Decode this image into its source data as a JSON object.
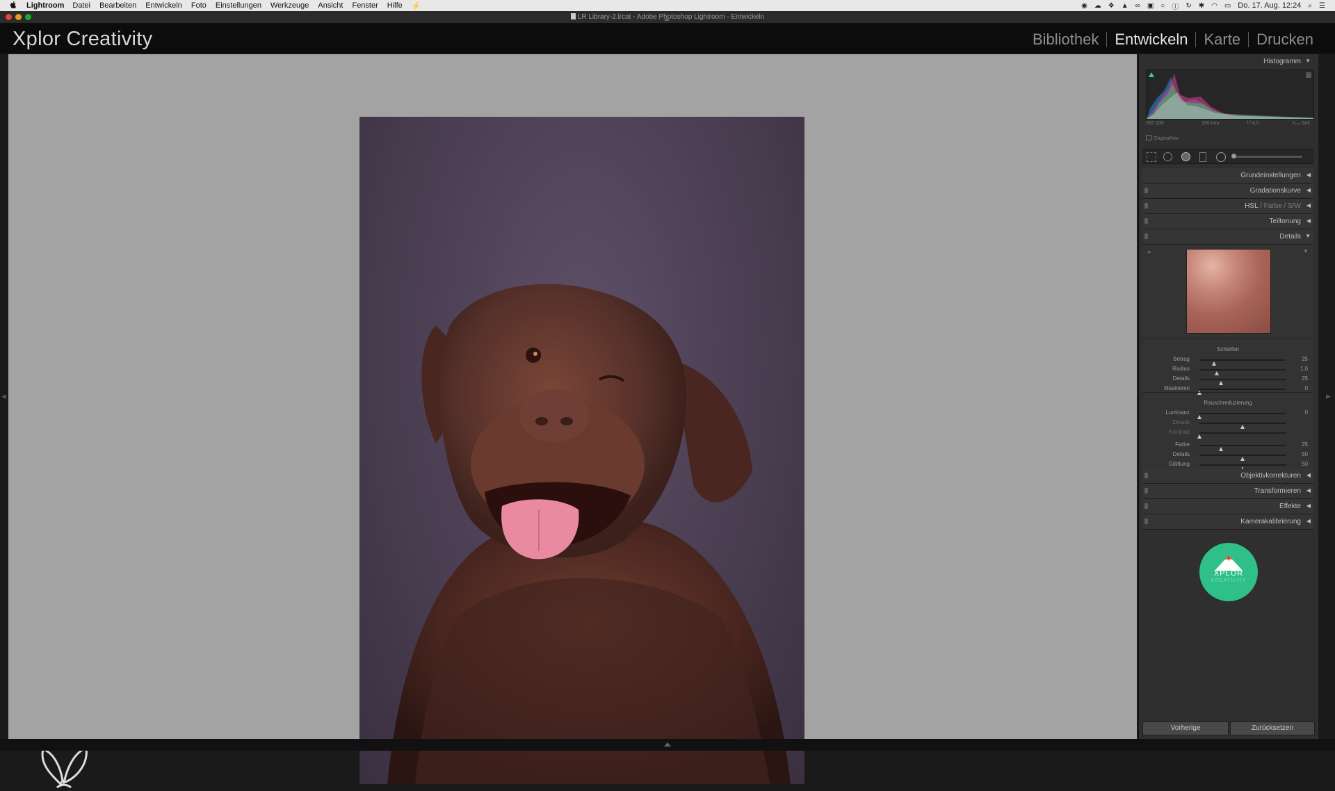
{
  "menubar": {
    "app": "Lightroom",
    "items": [
      "Datei",
      "Bearbeiten",
      "Entwickeln",
      "Foto",
      "Einstellungen",
      "Werkzeuge",
      "Ansicht",
      "Fenster",
      "Hilfe"
    ],
    "datetime": "Do. 17. Aug.  12:24"
  },
  "window": {
    "title": "LR Library-2.lrcat - Adobe Photoshop Lightroom - Entwickeln"
  },
  "identity": {
    "brand": "Xplor Creativity",
    "modules": [
      {
        "label": "Bibliothek",
        "active": false
      },
      {
        "label": "Entwickeln",
        "active": true
      },
      {
        "label": "Karte",
        "active": false
      },
      {
        "label": "Drucken",
        "active": false
      }
    ]
  },
  "histogram": {
    "title": "Histogramm",
    "iso": "ISO 100",
    "focal": "100 mm",
    "aperture": "f / 4,0",
    "shutter": "¹⁄₁₂₅ Sek.",
    "original_photo": "Originalfoto"
  },
  "panels": {
    "grundeinstellungen": "Grundeinstellungen",
    "gradationskurve": "Gradationskurve",
    "hsl": "HSL",
    "farbe": "Farbe",
    "sw": "S/W",
    "teiltonung": "Teiltonung",
    "details": "Details",
    "objektivkorrekturen": "Objektivkorrekturen",
    "transformieren": "Transformieren",
    "effekte": "Effekte",
    "kamerakalibrierung": "Kamerakalibrierung"
  },
  "details": {
    "schaerfen_title": "Schärfen",
    "schaerfen": [
      {
        "label": "Betrag",
        "value": "25",
        "pos": 0.17
      },
      {
        "label": "Radius",
        "value": "1,0",
        "pos": 0.2
      },
      {
        "label": "Details",
        "value": "25",
        "pos": 0.25
      },
      {
        "label": "Maskieren",
        "value": "0",
        "pos": 0.0
      }
    ],
    "rauschen_title": "Rauschreduzierung",
    "rauschen_lum": [
      {
        "label": "Luminanz",
        "value": "0",
        "pos": 0.0,
        "dim": false
      },
      {
        "label": "Details",
        "value": "",
        "pos": 0.5,
        "dim": true
      },
      {
        "label": "Kontrast",
        "value": "",
        "pos": 0.0,
        "dim": true
      }
    ],
    "rauschen_color": [
      {
        "label": "Farbe",
        "value": "25",
        "pos": 0.25
      },
      {
        "label": "Details",
        "value": "50",
        "pos": 0.5
      },
      {
        "label": "Glättung",
        "value": "50",
        "pos": 0.5
      }
    ]
  },
  "logo": {
    "line1": "XPLOR",
    "line2": "CREATIVITY"
  },
  "buttons": {
    "previous": "Vorherige",
    "reset": "Zurücksetzen"
  },
  "colors": {
    "accent_logo": "#2fc08a",
    "canvas_bg": "#a3a3a3",
    "panel_bg": "#2f2f2f"
  }
}
